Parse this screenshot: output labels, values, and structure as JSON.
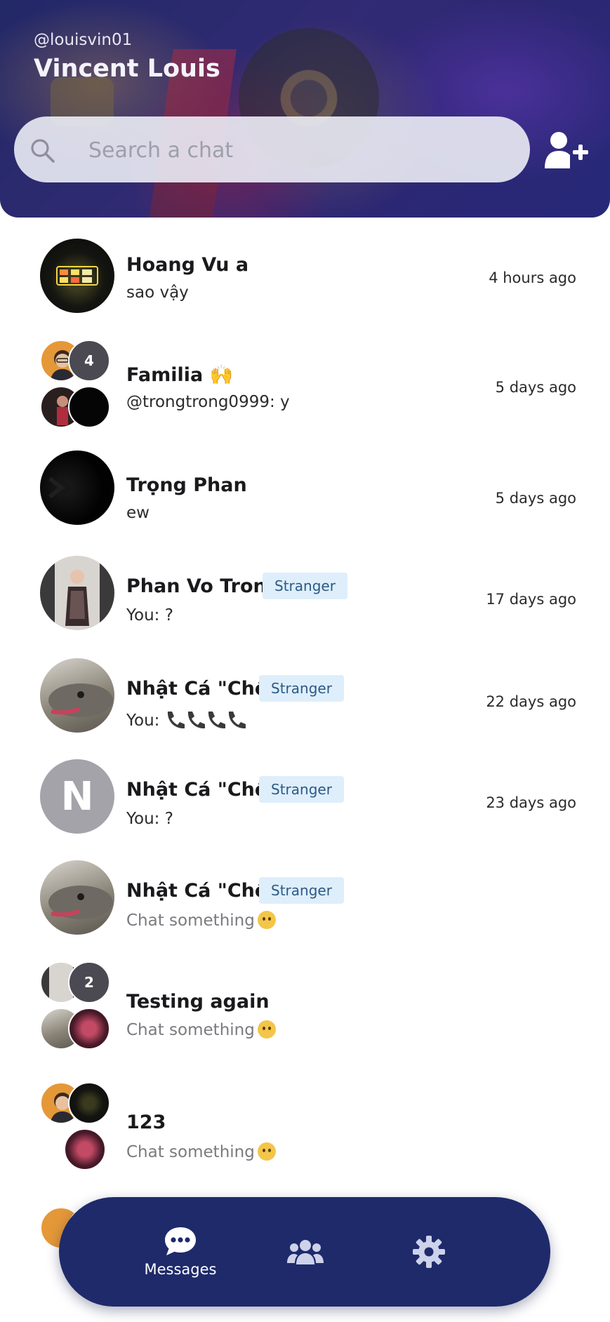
{
  "profile": {
    "username": "@louisvin01",
    "name": "Vincent Louis"
  },
  "search": {
    "placeholder": "Search a chat",
    "value": ""
  },
  "colors": {
    "accent": "#1e2a6a",
    "badge_bg": "#deeefb",
    "badge_text": "#2c5a86"
  },
  "icons": {
    "search": "search-icon",
    "add_user": "user-plus-icon",
    "messages": "chat-bubble-icon",
    "contacts": "users-icon",
    "settings": "gear-icon"
  },
  "chats": [
    {
      "name": "Hoang Vu a",
      "preview": "sao vậy",
      "time": "4 hours ago"
    },
    {
      "name": "Familia 🙌",
      "preview": "@trongtrong0999: y",
      "time": "5 days ago",
      "group_count": "4"
    },
    {
      "name": "Trọng Phan",
      "preview": "ew",
      "time": "5 days ago"
    },
    {
      "name": "Phan Vo Trong",
      "badge": "Stranger",
      "preview": "You: ?",
      "time": "17 days ago"
    },
    {
      "name": "Nhật Cá \"Chê\"",
      "badge": "Stranger",
      "preview": "You:",
      "time": "22 days ago"
    },
    {
      "name": "Nhật Cá \"Chê\"",
      "badge": "Stranger",
      "preview": "You: ?",
      "time": "23 days ago",
      "initial": "N"
    },
    {
      "name": "Nhật Cá \"Chê\"",
      "badge": "Stranger",
      "preview": "Chat something",
      "time": ""
    },
    {
      "name": "Testing again",
      "preview": "Chat something",
      "time": "",
      "group_count": "2"
    },
    {
      "name": "123",
      "preview": "Chat something",
      "time": ""
    }
  ],
  "nav": {
    "messages": "Messages"
  }
}
